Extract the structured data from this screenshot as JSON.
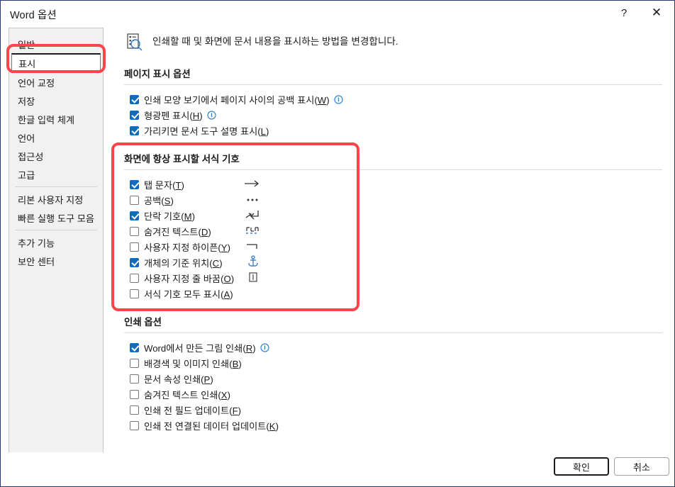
{
  "window": {
    "title": "Word 옵션",
    "help_label": "?",
    "close_label": "✕"
  },
  "sidebar": {
    "items": [
      {
        "label": "일반",
        "selected": false
      },
      {
        "label": "표시",
        "selected": true
      },
      {
        "label": "언어 교정",
        "selected": false
      },
      {
        "label": "저장",
        "selected": false
      },
      {
        "label": "한글 입력 체계",
        "selected": false
      },
      {
        "label": "언어",
        "selected": false
      },
      {
        "label": "접근성",
        "selected": false
      },
      {
        "label": "고급",
        "selected": false
      },
      {
        "label": "리본 사용자 지정",
        "selected": false
      },
      {
        "label": "빠른 실행 도구 모음",
        "selected": false
      },
      {
        "label": "추가 기능",
        "selected": false
      },
      {
        "label": "보안 센터",
        "selected": false
      }
    ]
  },
  "header": {
    "icon": "display-settings-icon",
    "description": "인쇄할 때 및 화면에 문서 내용을 표시하는 방법을 변경합니다."
  },
  "sections": [
    {
      "id": "page-display-options",
      "title": "페이지 표시 옵션",
      "options": [
        {
          "label": "인쇄 모양 보기에서 페이지 사이의 공백 표시",
          "accel": "W",
          "checked": true,
          "info": true,
          "symbol": ""
        },
        {
          "label": "형광펜 표시",
          "accel": "H",
          "checked": true,
          "info": true,
          "symbol": ""
        },
        {
          "label": "가리키면 문서 도구 설명 표시",
          "accel": "L",
          "checked": true,
          "info": false,
          "symbol": ""
        }
      ]
    },
    {
      "id": "always-show-formatting-marks",
      "title": "화면에 항상 표시할 서식 기호",
      "options": [
        {
          "label": "탭 문자",
          "accel": "T",
          "checked": true,
          "info": false,
          "symbol": "tab-arrow-icon"
        },
        {
          "label": "공백",
          "accel": "S",
          "checked": false,
          "info": false,
          "symbol": "space-dots-icon"
        },
        {
          "label": "단락 기호",
          "accel": "M",
          "checked": true,
          "info": false,
          "symbol": "paragraph-return-icon"
        },
        {
          "label": "숨겨진 텍스트",
          "accel": "D",
          "checked": false,
          "info": false,
          "symbol": "hidden-text-icon"
        },
        {
          "label": "사용자 지정 하이픈",
          "accel": "Y",
          "checked": false,
          "info": false,
          "symbol": "optional-hyphen-icon"
        },
        {
          "label": "개체의 기준 위치",
          "accel": "C",
          "checked": true,
          "info": false,
          "symbol": "anchor-icon"
        },
        {
          "label": "사용자 지정 줄 바꿈",
          "accel": "O",
          "checked": false,
          "info": false,
          "symbol": "optional-break-icon"
        },
        {
          "label": "서식 기호 모두 표시",
          "accel": "A",
          "checked": false,
          "info": false,
          "symbol": ""
        }
      ]
    },
    {
      "id": "print-options",
      "title": "인쇄 옵션",
      "options": [
        {
          "label": "Word에서 만든 그림 인쇄",
          "accel": "R",
          "checked": true,
          "info": true,
          "symbol": ""
        },
        {
          "label": "배경색 및 이미지 인쇄",
          "accel": "B",
          "checked": false,
          "info": false,
          "symbol": ""
        },
        {
          "label": "문서 속성 인쇄",
          "accel": "P",
          "checked": false,
          "info": false,
          "symbol": ""
        },
        {
          "label": "숨겨진 텍스트 인쇄",
          "accel": "X",
          "checked": false,
          "info": false,
          "symbol": ""
        },
        {
          "label": "인쇄 전 필드 업데이트",
          "accel": "F",
          "checked": false,
          "info": false,
          "symbol": ""
        },
        {
          "label": "인쇄 전 연결된 데이터 업데이트",
          "accel": "K",
          "checked": false,
          "info": false,
          "symbol": ""
        }
      ]
    }
  ],
  "footer": {
    "ok_label": "확인",
    "cancel_label": "취소"
  },
  "annotations": {
    "color": "#f9454b",
    "boxes": [
      "sidebar-display-item",
      "formatting-marks-section"
    ]
  }
}
